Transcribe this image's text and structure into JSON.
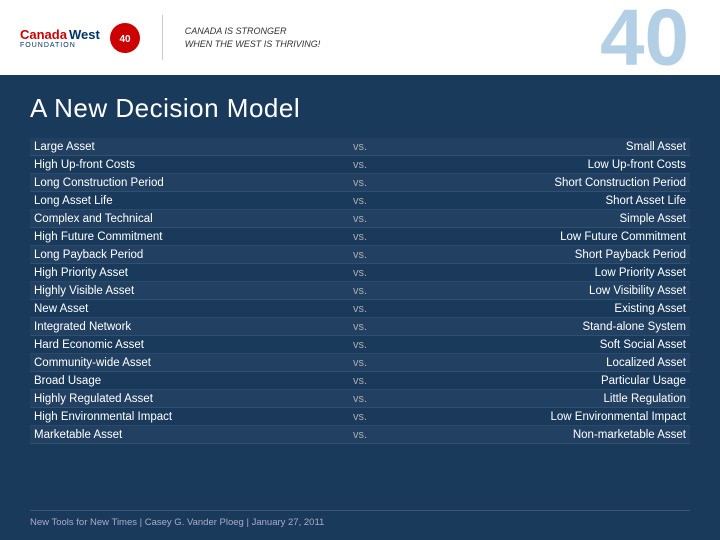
{
  "header": {
    "logo_canada": "Canada",
    "logo_west": "West",
    "logo_foundation": "FOUNDATION",
    "logo_years": "40",
    "tagline_line1": "CANADA IS STRONGER",
    "tagline_line2": "WHEN THE WEST IS THRIVING!",
    "big_number": "40"
  },
  "page": {
    "title": "A New Decision Model"
  },
  "table": {
    "vs_label": "vs.",
    "rows": [
      {
        "left": "Large Asset",
        "right": "Small Asset"
      },
      {
        "left": "High Up-front Costs",
        "right": "Low Up-front Costs"
      },
      {
        "left": "Long Construction Period",
        "right": "Short Construction Period"
      },
      {
        "left": "Long Asset Life",
        "right": "Short Asset Life"
      },
      {
        "left": "Complex and Technical",
        "right": "Simple Asset"
      },
      {
        "left": "High Future Commitment",
        "right": "Low Future Commitment"
      },
      {
        "left": "Long Payback Period",
        "right": "Short Payback Period"
      },
      {
        "left": "High Priority Asset",
        "right": "Low Priority Asset"
      },
      {
        "left": "Highly Visible Asset",
        "right": "Low Visibility Asset"
      },
      {
        "left": "New Asset",
        "right": "Existing Asset"
      },
      {
        "left": "Integrated Network",
        "right": "Stand-alone System"
      },
      {
        "left": "Hard Economic Asset",
        "right": "Soft Social Asset"
      },
      {
        "left": "Community-wide Asset",
        "right": "Localized Asset"
      },
      {
        "left": "Broad Usage",
        "right": "Particular Usage"
      },
      {
        "left": "Highly Regulated Asset",
        "right": "Little Regulation"
      },
      {
        "left": "High Environmental Impact",
        "right": "Low Environmental Impact"
      },
      {
        "left": "Marketable Asset",
        "right": "Non-marketable Asset"
      }
    ]
  },
  "footer": {
    "text": "New Tools for New Times  |  Casey G. Vander Ploeg  |  January 27, 2011"
  }
}
